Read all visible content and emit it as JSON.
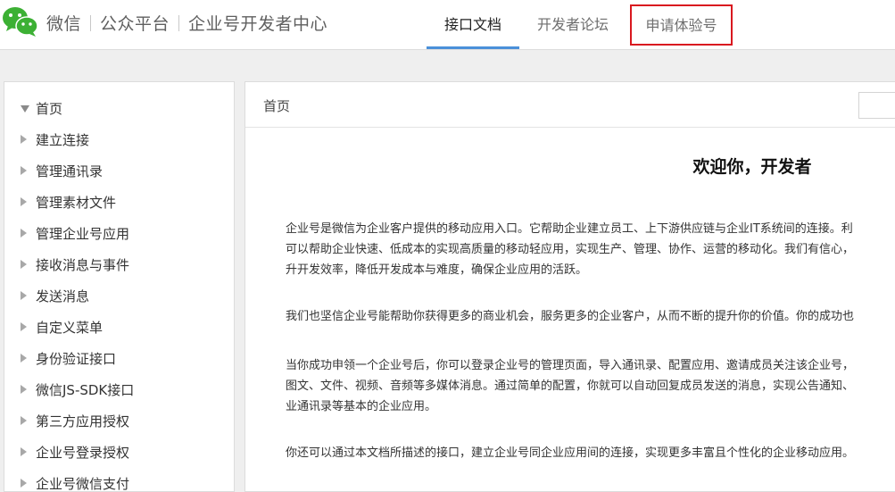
{
  "header": {
    "brand_parts": [
      "微信",
      "公众平台",
      "企业号开发者中心"
    ],
    "tabs": [
      {
        "label": "接口文档",
        "active": true
      },
      {
        "label": "开发者论坛",
        "active": false
      }
    ],
    "apply_label": "申请体验号",
    "accent_color": "#4a90d9",
    "highlight_color": "#d9181f",
    "logo_icon": "wechat-logo-icon"
  },
  "sidebar": {
    "items": [
      {
        "label": "首页",
        "expanded": true
      },
      {
        "label": "建立连接",
        "expanded": false
      },
      {
        "label": "管理通讯录",
        "expanded": false
      },
      {
        "label": "管理素材文件",
        "expanded": false
      },
      {
        "label": "管理企业号应用",
        "expanded": false
      },
      {
        "label": "接收消息与事件",
        "expanded": false
      },
      {
        "label": "发送消息",
        "expanded": false
      },
      {
        "label": "自定义菜单",
        "expanded": false
      },
      {
        "label": "身份验证接口",
        "expanded": false
      },
      {
        "label": "微信JS-SDK接口",
        "expanded": false
      },
      {
        "label": "第三方应用授权",
        "expanded": false
      },
      {
        "label": "企业号登录授权",
        "expanded": false
      },
      {
        "label": "企业号微信支付",
        "expanded": false
      }
    ]
  },
  "main": {
    "breadcrumb": "首页",
    "search_value": "",
    "welcome_title": "欢迎你，开发者",
    "paragraphs": [
      {
        "lines": [
          "企业号是微信为企业客户提供的移动应用入口。它帮助企业建立员工、上下游供应链与企业IT系统间的连接。利",
          "可以帮助企业快速、低成本的实现高质量的移动轻应用，实现生产、管理、协作、运营的移动化。我们有信心，",
          "升开发效率，降低开发成本与难度，确保企业应用的活跃。"
        ]
      },
      {
        "lines": [
          "我们也坚信企业号能帮助你获得更多的商业机会，服务更多的企业客户，从而不断的提升你的价值。你的成功也"
        ]
      },
      {
        "lines": [
          "当你成功申领一个企业号后，你可以登录企业号的管理页面，导入通讯录、配置应用、邀请成员关注该企业号，",
          "图文、文件、视频、音频等多媒体消息。通过简单的配置，你就可以自动回复成员发送的消息，实现公告通知、",
          "业通讯录等基本的企业应用。"
        ]
      },
      {
        "lines": [
          "你还可以通过本文档所描述的接口，建立企业号同企业应用间的连接，实现更多丰富且个性化的企业移动应用。"
        ]
      }
    ]
  }
}
